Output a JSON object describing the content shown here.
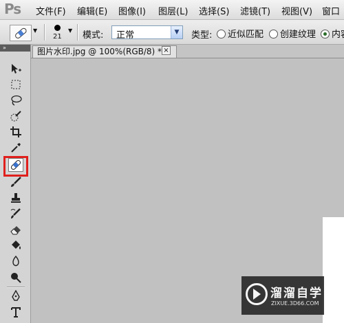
{
  "app": {
    "logo": "Ps"
  },
  "menu": [
    {
      "label": "文件(F)"
    },
    {
      "label": "编辑(E)"
    },
    {
      "label": "图像(I)"
    },
    {
      "label": "图层(L)"
    },
    {
      "label": "选择(S)"
    },
    {
      "label": "滤镜(T)"
    },
    {
      "label": "视图(V)"
    },
    {
      "label": "窗口"
    }
  ],
  "options": {
    "brush_size": "21",
    "mode_label": "模式:",
    "mode_value": "正常",
    "type_label": "类型:",
    "type_options": [
      {
        "label": "近似匹配",
        "selected": false
      },
      {
        "label": "创建纹理",
        "selected": false
      },
      {
        "label": "内容",
        "selected": true
      }
    ]
  },
  "tools": [
    {
      "icon": "move-icon"
    },
    {
      "icon": "rectangular-marquee-icon"
    },
    {
      "icon": "lasso-icon"
    },
    {
      "icon": "quick-selection-icon"
    },
    {
      "icon": "crop-icon"
    },
    {
      "icon": "eyedropper-icon"
    },
    {
      "icon": "spot-healing-brush-icon",
      "selected": true
    },
    {
      "icon": "brush-icon"
    },
    {
      "icon": "clone-stamp-icon"
    },
    {
      "icon": "history-brush-icon"
    },
    {
      "icon": "eraser-icon"
    },
    {
      "icon": "paint-bucket-icon"
    },
    {
      "icon": "blur-icon"
    },
    {
      "icon": "dodge-icon"
    },
    {
      "icon": "pen-icon"
    },
    {
      "icon": "type-icon"
    }
  ],
  "document": {
    "tab_title": "图片水印.jpg @ 100%(RGB/8) *",
    "close_glyph": "×"
  },
  "colors": {
    "highlight": "#e0201d",
    "canvas_bg": "#c1c1c1"
  },
  "watermark": {
    "title": "溜溜自学",
    "url": "ZIXUE.3D66.COM"
  }
}
